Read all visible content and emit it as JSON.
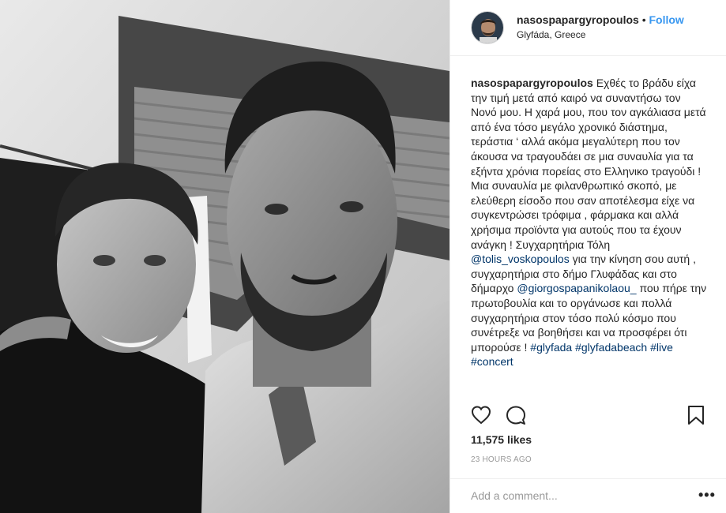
{
  "post": {
    "username": "nasospapargyropoulos",
    "dot": "•",
    "follow_label": "Follow",
    "location": "Glyfáda, Greece",
    "caption_username": "nasospapargyropoulos",
    "caption_text_1": " Εχθές το βράδυ είχα την τιμή μετά από καιρό να συναντήσω τον Νονό μου. Η χαρά μου, που τον αγκάλιασα μετά από ένα τόσο μεγάλο χρονικό διάστημα, τεράστια ‘ αλλά ακόμα μεγαλύτερη που τον άκουσα να τραγουδάει σε μια συναυλία για τα εξήντα χρόνια πορείας στο Ελληνικο τραγούδι ! Μια συναυλία με φιλανθρωπικό σκοπό, με ελεύθερη είσοδο που σαν αποτέλεσμα είχε να συγκεντρώσει τρόφιμα , φάρμακα και αλλά χρήσιμα προϊόντα για αυτούς που τα έχουν ανάγκη ! Συγχαρητήρια Τόλη ",
    "mention_1": "@tolis_voskopoulos",
    "caption_text_2": " για την κίνηση σου αυτή , συγχαρητήρια στο δήμο Γλυφάδας και στο δήμαρχο ",
    "mention_2": "@giorgospapanikolaou_",
    "caption_text_3": " που πήρε την πρωτοβουλία και το οργάνωσε και πολλά συγχαρητήρια στον τόσο πολύ κόσμο που συνέτρεξε να βοηθήσει και να προσφέρει ότι μπορούσε ! ",
    "hashtags": [
      "#glyfada",
      "#glyfadabeach",
      "#live",
      "#concert"
    ],
    "likes": "11,575 likes",
    "timestamp": "23 HOURS AGO",
    "comment_placeholder": "Add a comment...",
    "more_label": "•••"
  },
  "icons": {
    "like": "heart-icon",
    "comment": "comment-icon",
    "save": "bookmark-icon"
  },
  "colors": {
    "link": "#003569",
    "follow": "#3897f0",
    "text": "#262626",
    "muted": "#999999",
    "border": "#efefef"
  }
}
